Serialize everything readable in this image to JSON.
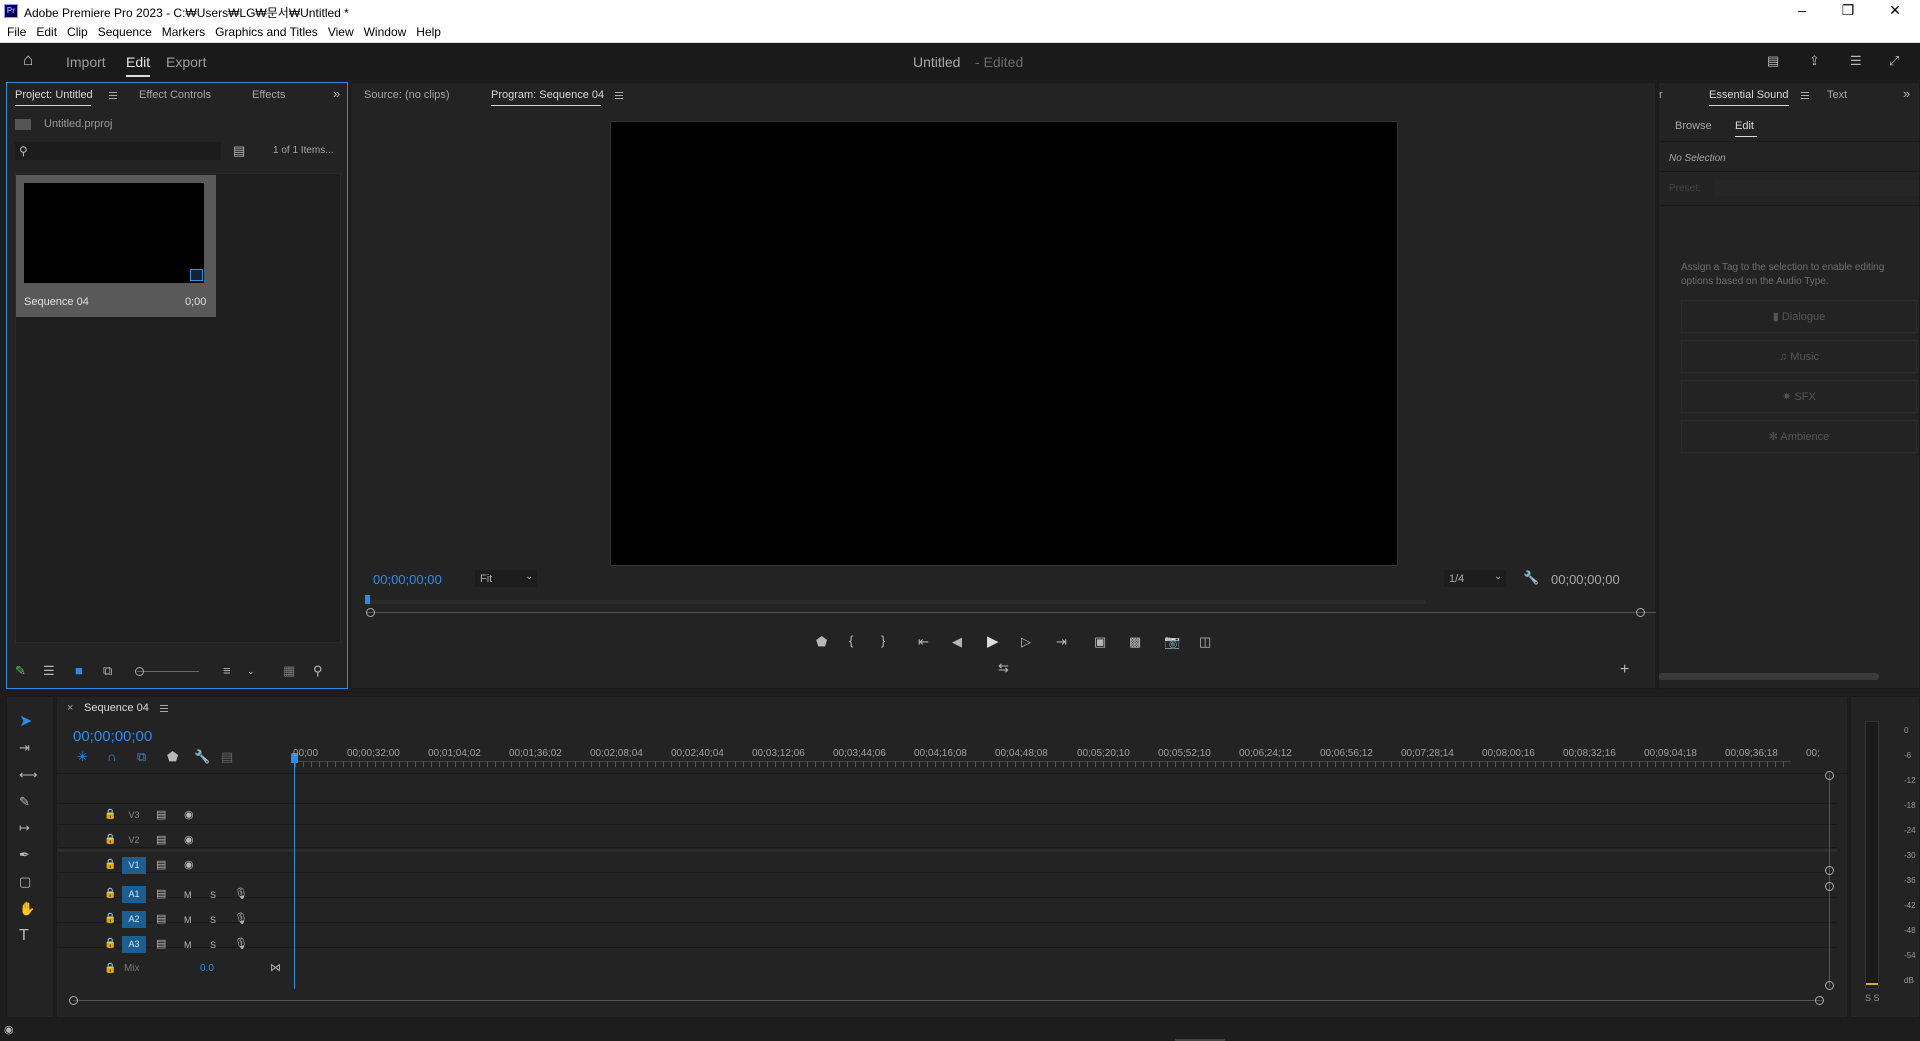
{
  "window": {
    "title": "Adobe Premiere Pro 2023 - C:₩Users₩LG₩문서₩Untitled *",
    "app_icon": "Pr"
  },
  "menu": [
    "File",
    "Edit",
    "Clip",
    "Sequence",
    "Markers",
    "Graphics and Titles",
    "View",
    "Window",
    "Help"
  ],
  "header": {
    "tabs": [
      "Import",
      "Edit",
      "Export"
    ],
    "active_tab": "Edit",
    "doc_title": "Untitled",
    "doc_state": "- Edited"
  },
  "project_panel": {
    "tabs": [
      "Project: Untitled",
      "Effect Controls",
      "Effects"
    ],
    "file_name": "Untitled.prproj",
    "item_count": "1 of 1 Items...",
    "item": {
      "name": "Sequence 04",
      "duration": "0;00"
    }
  },
  "source_panel": {
    "tab": "Source: (no clips)"
  },
  "program_panel": {
    "tab": "Program: Sequence 04",
    "timecode_left": "00;00;00;00",
    "fit": "Fit",
    "resolution": "1/4",
    "timecode_right": "00;00;00;00"
  },
  "essential_sound": {
    "tabs": [
      "Essential Sound",
      "Text"
    ],
    "subtabs": [
      "Browse",
      "Edit"
    ],
    "active_subtab": "Edit",
    "no_selection": "No Selection",
    "preset_label": "Preset:",
    "assign_text": "Assign a Tag to the selection to enable editing options based on the Audio Type.",
    "types": [
      "Dialogue",
      "Music",
      "SFX",
      "Ambience"
    ]
  },
  "timeline": {
    "tab": "Sequence 04",
    "close": "×",
    "timecode": "00;00;00;00",
    "ruler": [
      "00;00",
      "00;00;32;00",
      "00;01;04;02",
      "00;01;36;02",
      "00;02;08;04",
      "00;02;40;04",
      "00;03;12;06",
      "00;03;44;06",
      "00;04;16;08",
      "00;04;48;08",
      "00;05;20;10",
      "00;05;52;10",
      "00;06;24;12",
      "00;06;56;12",
      "00;07;28;14",
      "00;08;00;16",
      "00;08;32;16",
      "00;09;04;18",
      "00;09;36;18",
      "00;"
    ],
    "video_tracks": [
      "V3",
      "V2",
      "V1"
    ],
    "audio_tracks": [
      "A1",
      "A2",
      "A3"
    ],
    "mix_label": "Mix",
    "mix_value": "0.0",
    "m_label": "M",
    "s_label": "S"
  },
  "meter": {
    "labels": [
      "0",
      "-6",
      "-12",
      "-18",
      "-24",
      "-30",
      "-36",
      "-42",
      "-48",
      "-54",
      "dB"
    ],
    "solo": "S S"
  },
  "colors": {
    "accent": "#2d8ceb",
    "track_on": "#1c5e8f",
    "panel": "#232323",
    "bg": "#1d1d1d"
  }
}
